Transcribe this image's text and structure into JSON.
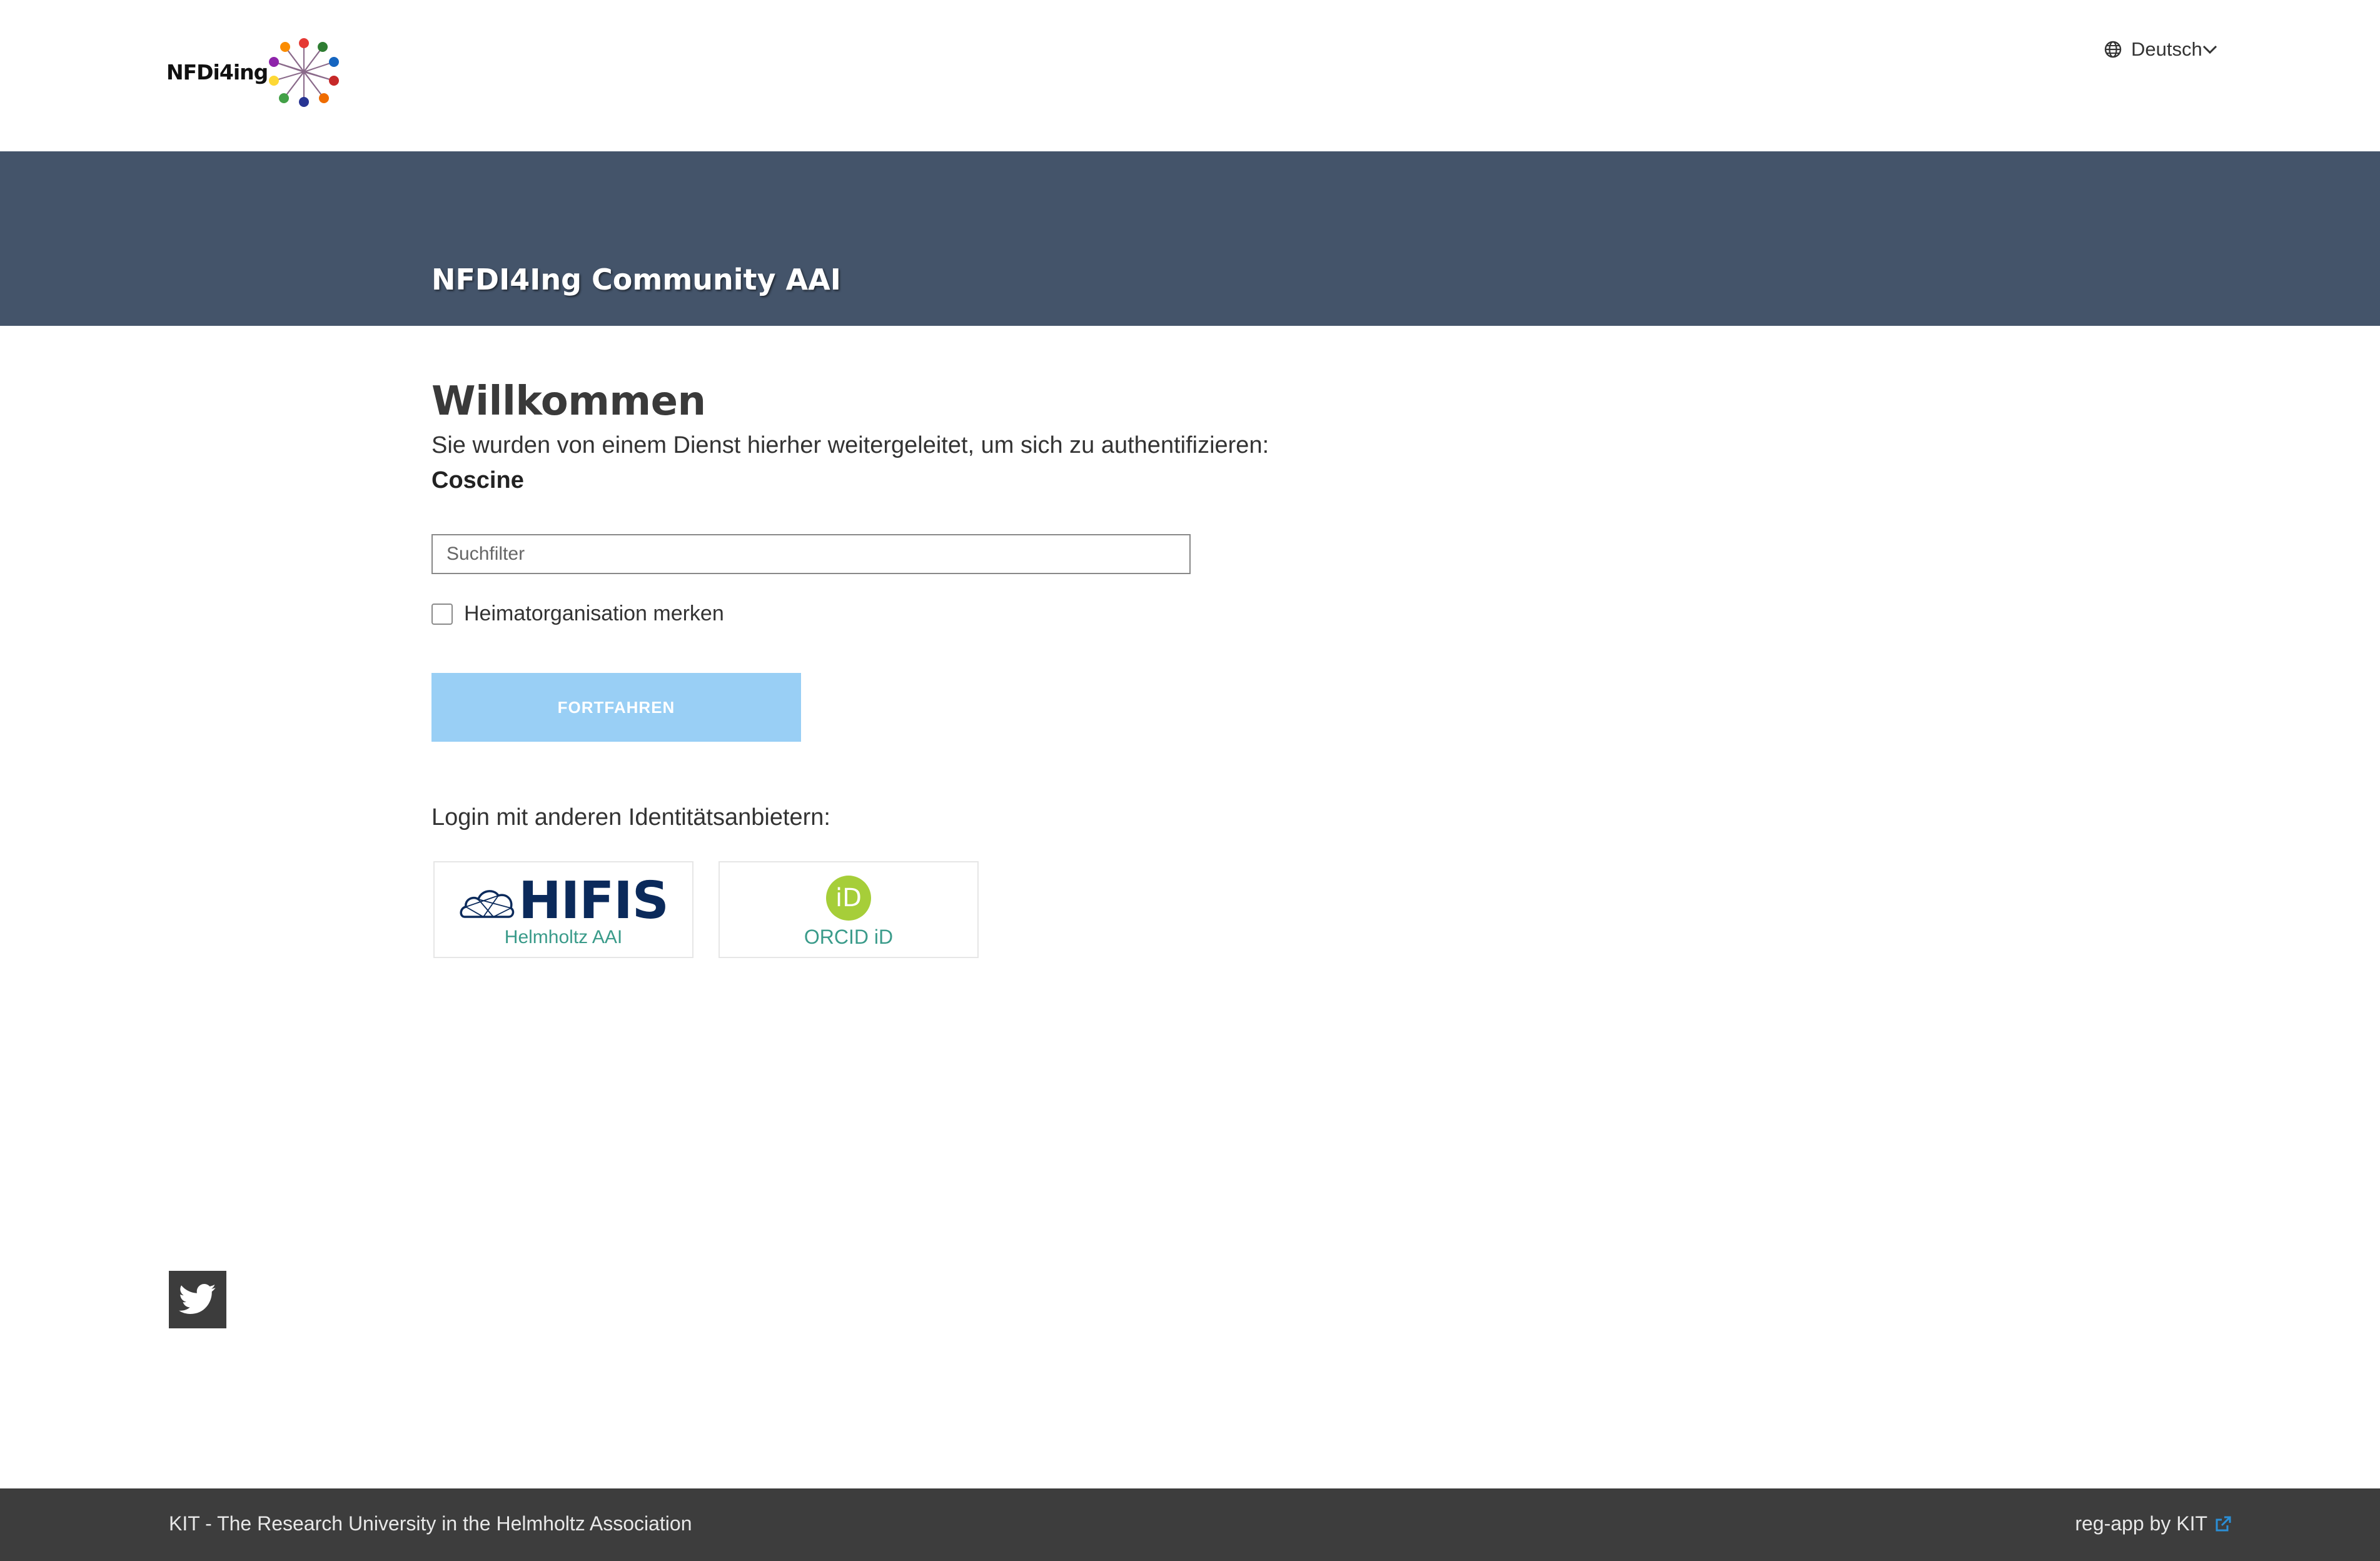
{
  "header": {
    "logo_text": "NFDi4ing",
    "language_selected": "Deutsch"
  },
  "banner": {
    "title": "NFDI4Ing Community AAI"
  },
  "main": {
    "welcome_title": "Willkommen",
    "redirect_text": "Sie wurden von einem Dienst hierher weitergeleitet, um sich zu authentifizieren:",
    "service_name": "Coscine",
    "search_placeholder": "Suchfilter",
    "remember_label": "Heimatorganisation merken",
    "continue_label": "FORTFAHREN",
    "other_providers_label": "Login mit anderen Identitätsanbietern:",
    "providers": [
      {
        "logo_text": "HIFIS",
        "label": "Helmholtz AAI"
      },
      {
        "logo_text": "iD",
        "label": "ORCID iD"
      }
    ]
  },
  "footer": {
    "left_text": "KIT - The Research University in the Helmholtz Association",
    "right_text": "reg-app by KIT"
  },
  "colors": {
    "banner": "#44546a",
    "button": "#99cff5",
    "footer": "#3d3d3d",
    "orcid": "#a6ce39",
    "hifis": "#0b2a5b"
  },
  "icons": {
    "logo": "nfdi4ing-logo",
    "language": "globe-icon",
    "dropdown": "chevron-down-icon",
    "social": "twitter-icon",
    "external": "external-link-icon"
  }
}
